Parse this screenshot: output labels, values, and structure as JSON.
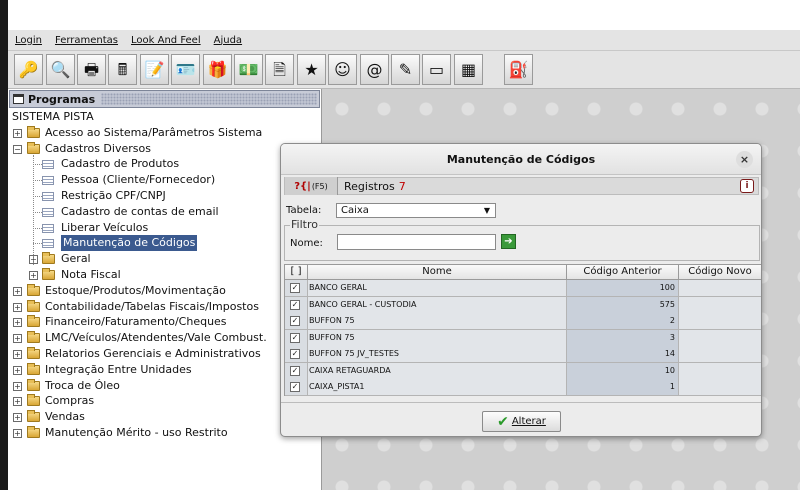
{
  "menu": {
    "items": [
      "Login",
      "Ferramentas",
      "Look And Feel",
      "Ajuda"
    ]
  },
  "toolbar": {
    "buttons": [
      {
        "icon": "key-person-icon",
        "glyph": "🔑"
      },
      {
        "icon": "magnifier-icon",
        "glyph": "🔍"
      },
      {
        "icon": "printer-icon",
        "glyph": "🖶"
      },
      {
        "icon": "cash-register-icon",
        "glyph": "🖩"
      },
      {
        "icon": "notepad-icon",
        "glyph": "📝"
      },
      {
        "icon": "id-card-icon",
        "glyph": "🪪"
      },
      {
        "icon": "gift-box-icon",
        "glyph": "🎁"
      },
      {
        "icon": "money-icon",
        "glyph": "💵"
      },
      {
        "icon": "nfe-document-icon",
        "glyph": "🗎"
      },
      {
        "icon": "star-icon",
        "glyph": "★"
      },
      {
        "icon": "smiley-face-icon",
        "glyph": "☺"
      },
      {
        "icon": "at-sign-icon",
        "glyph": "@"
      },
      {
        "icon": "pen-check-icon",
        "glyph": "✎"
      },
      {
        "icon": "card-icon",
        "glyph": "▭"
      },
      {
        "icon": "calculator-icon",
        "glyph": "▦"
      },
      {
        "icon": "fuel-pump-icon",
        "glyph": "⛽"
      }
    ]
  },
  "programs": {
    "title": "Programas",
    "root": "SISTEMA PISTA",
    "items": [
      {
        "label": "Acesso ao Sistema/Parâmetros Sistema",
        "level": 1,
        "type": "folder",
        "expanded": false
      },
      {
        "label": "Cadastros Diversos",
        "level": 1,
        "type": "folder",
        "expanded": true
      },
      {
        "label": "Cadastro de Produtos",
        "level": 2,
        "type": "leaf"
      },
      {
        "label": "Pessoa (Cliente/Fornecedor)",
        "level": 2,
        "type": "leaf"
      },
      {
        "label": "Restrição CPF/CNPJ",
        "level": 2,
        "type": "leaf"
      },
      {
        "label": "Cadastro de contas de email",
        "level": 2,
        "type": "leaf"
      },
      {
        "label": "Liberar Veículos",
        "level": 2,
        "type": "leaf"
      },
      {
        "label": "Manutenção de Códigos",
        "level": 2,
        "type": "leaf",
        "selected": true
      },
      {
        "label": "Geral",
        "level": 2,
        "type": "folder",
        "expanded": false
      },
      {
        "label": "Nota Fiscal",
        "level": 2,
        "type": "folder",
        "expanded": false
      },
      {
        "label": "Estoque/Produtos/Movimentação",
        "level": 1,
        "type": "folder",
        "expanded": false
      },
      {
        "label": "Contabilidade/Tabelas Fiscais/Impostos",
        "level": 1,
        "type": "folder",
        "expanded": false
      },
      {
        "label": "Financeiro/Faturamento/Cheques",
        "level": 1,
        "type": "folder",
        "expanded": false
      },
      {
        "label": "LMC/Veículos/Atendentes/Vale Combust.",
        "level": 1,
        "type": "folder",
        "expanded": false
      },
      {
        "label": "Relatorios Gerenciais e Administrativos",
        "level": 1,
        "type": "folder",
        "expanded": false
      },
      {
        "label": "Integração Entre Unidades",
        "level": 1,
        "type": "folder",
        "expanded": false
      },
      {
        "label": "Troca de Óleo",
        "level": 1,
        "type": "folder",
        "expanded": false
      },
      {
        "label": "Compras",
        "level": 1,
        "type": "folder",
        "expanded": false
      },
      {
        "label": "Vendas",
        "level": 1,
        "type": "folder",
        "expanded": false
      },
      {
        "label": "Manutenção Mérito - uso Restrito",
        "level": 1,
        "type": "folder",
        "expanded": false
      }
    ]
  },
  "dialog": {
    "title": "Manutenção de Códigos",
    "close_icon": "×",
    "help_label": "(F5)",
    "registros_label": "Registros",
    "registros_count": "7",
    "tabela_label": "Tabela:",
    "tabela_value": "Caixa",
    "filtro_label": "Filtro",
    "nome_label": "Nome:",
    "nome_value": "",
    "columns": [
      "[ ]",
      "Nome",
      "Código Anterior",
      "Código Novo"
    ],
    "rows": [
      {
        "checked": true,
        "nome": "BANCO GERAL",
        "anterior": "100",
        "novo": ""
      },
      {
        "checked": true,
        "nome": "BANCO GERAL - CUSTODIA",
        "anterior": "575",
        "novo": ""
      },
      {
        "checked": true,
        "nome": "BUFFON 75",
        "anterior": "2",
        "novo": ""
      },
      {
        "checked": true,
        "nome": "BUFFON 75",
        "anterior": "3",
        "novo": ""
      },
      {
        "checked": true,
        "nome": "BUFFON 75 JV_TESTES",
        "anterior": "14",
        "novo": ""
      },
      {
        "checked": true,
        "nome": "CAIXA RETAGUARDA",
        "anterior": "10",
        "novo": ""
      },
      {
        "checked": true,
        "nome": "CAIXA_PISTA1",
        "anterior": "1",
        "novo": ""
      }
    ],
    "alterar_label": "Alterar"
  }
}
